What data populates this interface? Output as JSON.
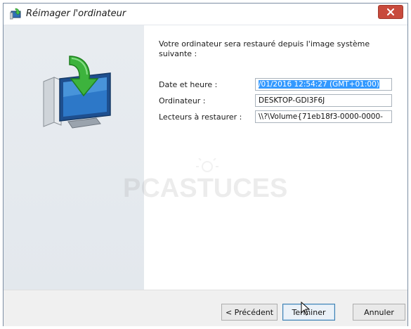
{
  "window": {
    "title": "Réimager l'ordinateur"
  },
  "content": {
    "intro": "Votre ordinateur sera restauré depuis l'image système suivante :",
    "rows": [
      {
        "label": "Date et heure :",
        "value": "/01/2016 12:54:27 (GMT+01:00)"
      },
      {
        "label": "Ordinateur :",
        "value": "DESKTOP-GDI3F6J"
      },
      {
        "label": "Lecteurs à restaurer :",
        "value": "\\\\?\\Volume{71eb18f3-0000-0000-"
      }
    ]
  },
  "watermark": {
    "text": "PCASTUCES"
  },
  "footer": {
    "back_label": "< Précédent",
    "finish_label": "Terminer",
    "cancel_label": "Annuler"
  },
  "icons": {
    "title": "restore-computer-icon",
    "close": "close-icon",
    "hero": "restore-computer-graphic"
  },
  "colors": {
    "accent": "#3399ff",
    "close": "#c84a3c",
    "panel": "#e6eaee"
  }
}
